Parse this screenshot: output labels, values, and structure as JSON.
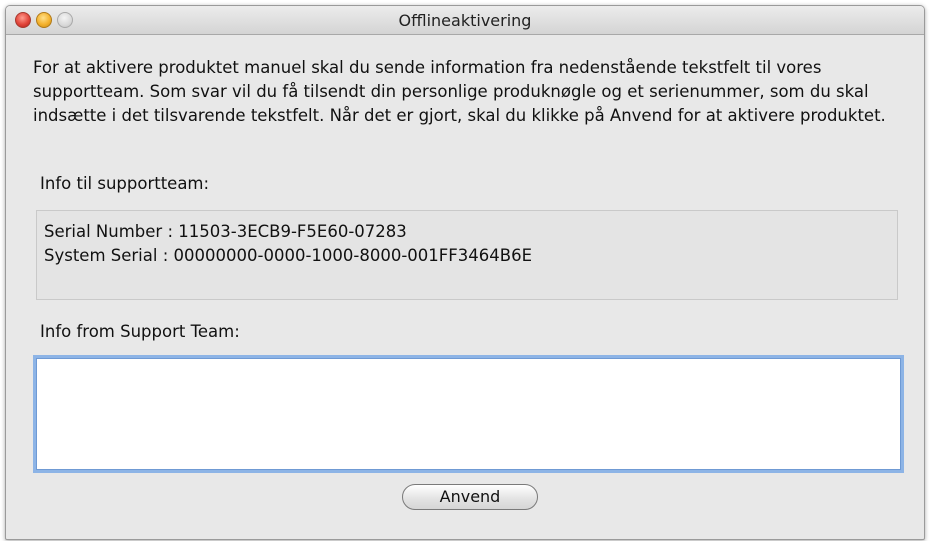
{
  "window": {
    "title": "Offlineaktivering"
  },
  "dialog": {
    "description": "For at aktivere produktet manuel skal du sende information fra nedenstående tekstfelt til vores supportteam. Som svar vil du få tilsendt din personlige produknøgle og et serienummer, som du skal indsætte i det tilsvarende tekstfelt. Når det er gjort, skal du klikke på Anvend for at aktivere produktet.",
    "info_to_support_label": "Info til supportteam:",
    "info_to_support_lines": [
      "Serial Number : 11503-3ECB9-F5E60-07283",
      "System Serial : 00000000-0000-1000-8000-001FF3464B6E"
    ],
    "info_from_support_label": "Info from Support Team:",
    "info_from_support_value": "",
    "apply_label": "Anvend"
  }
}
